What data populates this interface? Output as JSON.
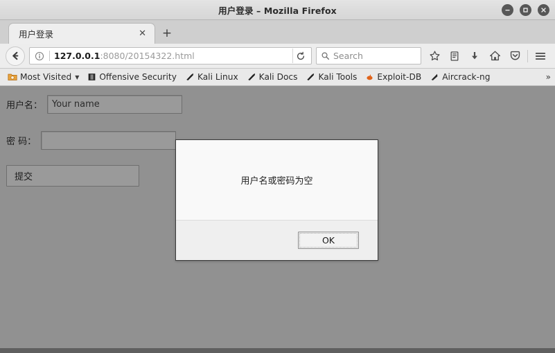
{
  "window": {
    "title": "用户登录 – Mozilla Firefox",
    "controls": [
      {
        "name": "minimize",
        "glyph": "minimize-icon"
      },
      {
        "name": "maximize",
        "glyph": "maximize-icon"
      },
      {
        "name": "close",
        "glyph": "close-icon"
      }
    ]
  },
  "tabs": {
    "items": [
      {
        "label": "用户登录",
        "close_label": "✕"
      }
    ],
    "new_tab_label": "+"
  },
  "navigation": {
    "back_icon": "back-arrow-icon",
    "identity_icon": "info-icon",
    "url_host": "127.0.0.1",
    "url_rest": ":8080/20154322.html",
    "url_full": "127.0.0.1:8080/20154322.html",
    "reload_icon": "reload-icon",
    "search_placeholder": "Search",
    "search_icon": "search-icon",
    "tools": [
      {
        "name": "bookmark-star-icon",
        "label": ""
      },
      {
        "name": "library-icon",
        "label": ""
      },
      {
        "name": "downloads-icon",
        "label": ""
      },
      {
        "name": "home-icon",
        "label": ""
      },
      {
        "name": "pocket-icon",
        "label": ""
      },
      {
        "name": "menu-icon",
        "label": ""
      }
    ]
  },
  "bookmarks": {
    "items": [
      {
        "label": "Most Visited",
        "icon": "folder-star-icon",
        "color": "#d98512",
        "has_chevron": true
      },
      {
        "label": "Offensive Security",
        "icon": "offsec-icon",
        "color": "#2a2a2a",
        "has_chevron": false
      },
      {
        "label": "Kali Linux",
        "icon": "kali-dragon-icon",
        "color": "#1f1f1f",
        "has_chevron": false
      },
      {
        "label": "Kali Docs",
        "icon": "kali-dragon-icon",
        "color": "#1f1f1f",
        "has_chevron": false
      },
      {
        "label": "Kali Tools",
        "icon": "kali-dragon-icon",
        "color": "#1f1f1f",
        "has_chevron": false
      },
      {
        "label": "Exploit-DB",
        "icon": "exploitdb-icon",
        "color": "#e0631a",
        "has_chevron": false
      },
      {
        "label": "Aircrack-ng",
        "icon": "aircrack-icon",
        "color": "#262626",
        "has_chevron": false
      }
    ],
    "overflow_label": "»"
  },
  "page": {
    "background_color": "#919191",
    "username_label": "用户名：",
    "username_placeholder": "Your name",
    "username_value": "",
    "password_label": "密 码：",
    "password_value": "",
    "submit_label": "提交"
  },
  "dialog": {
    "message": "用户名或密码为空",
    "ok_label": "OK"
  }
}
